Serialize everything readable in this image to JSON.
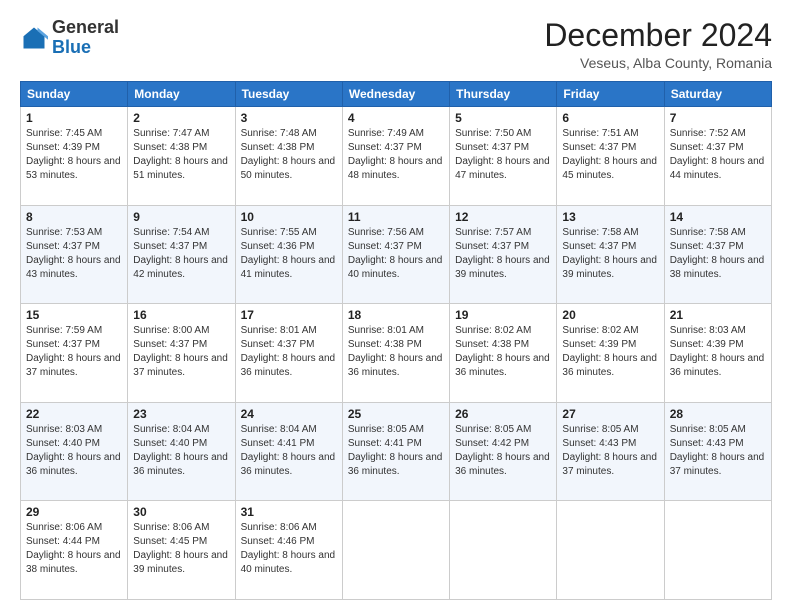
{
  "header": {
    "logo_line1": "General",
    "logo_line2": "Blue",
    "month_title": "December 2024",
    "location": "Veseus, Alba County, Romania"
  },
  "weekdays": [
    "Sunday",
    "Monday",
    "Tuesday",
    "Wednesday",
    "Thursday",
    "Friday",
    "Saturday"
  ],
  "weeks": [
    [
      {
        "day": "1",
        "sunrise": "7:45 AM",
        "sunset": "4:39 PM",
        "daylight": "8 hours and 53 minutes."
      },
      {
        "day": "2",
        "sunrise": "7:47 AM",
        "sunset": "4:38 PM",
        "daylight": "8 hours and 51 minutes."
      },
      {
        "day": "3",
        "sunrise": "7:48 AM",
        "sunset": "4:38 PM",
        "daylight": "8 hours and 50 minutes."
      },
      {
        "day": "4",
        "sunrise": "7:49 AM",
        "sunset": "4:37 PM",
        "daylight": "8 hours and 48 minutes."
      },
      {
        "day": "5",
        "sunrise": "7:50 AM",
        "sunset": "4:37 PM",
        "daylight": "8 hours and 47 minutes."
      },
      {
        "day": "6",
        "sunrise": "7:51 AM",
        "sunset": "4:37 PM",
        "daylight": "8 hours and 45 minutes."
      },
      {
        "day": "7",
        "sunrise": "7:52 AM",
        "sunset": "4:37 PM",
        "daylight": "8 hours and 44 minutes."
      }
    ],
    [
      {
        "day": "8",
        "sunrise": "7:53 AM",
        "sunset": "4:37 PM",
        "daylight": "8 hours and 43 minutes."
      },
      {
        "day": "9",
        "sunrise": "7:54 AM",
        "sunset": "4:37 PM",
        "daylight": "8 hours and 42 minutes."
      },
      {
        "day": "10",
        "sunrise": "7:55 AM",
        "sunset": "4:36 PM",
        "daylight": "8 hours and 41 minutes."
      },
      {
        "day": "11",
        "sunrise": "7:56 AM",
        "sunset": "4:37 PM",
        "daylight": "8 hours and 40 minutes."
      },
      {
        "day": "12",
        "sunrise": "7:57 AM",
        "sunset": "4:37 PM",
        "daylight": "8 hours and 39 minutes."
      },
      {
        "day": "13",
        "sunrise": "7:58 AM",
        "sunset": "4:37 PM",
        "daylight": "8 hours and 39 minutes."
      },
      {
        "day": "14",
        "sunrise": "7:58 AM",
        "sunset": "4:37 PM",
        "daylight": "8 hours and 38 minutes."
      }
    ],
    [
      {
        "day": "15",
        "sunrise": "7:59 AM",
        "sunset": "4:37 PM",
        "daylight": "8 hours and 37 minutes."
      },
      {
        "day": "16",
        "sunrise": "8:00 AM",
        "sunset": "4:37 PM",
        "daylight": "8 hours and 37 minutes."
      },
      {
        "day": "17",
        "sunrise": "8:01 AM",
        "sunset": "4:37 PM",
        "daylight": "8 hours and 36 minutes."
      },
      {
        "day": "18",
        "sunrise": "8:01 AM",
        "sunset": "4:38 PM",
        "daylight": "8 hours and 36 minutes."
      },
      {
        "day": "19",
        "sunrise": "8:02 AM",
        "sunset": "4:38 PM",
        "daylight": "8 hours and 36 minutes."
      },
      {
        "day": "20",
        "sunrise": "8:02 AM",
        "sunset": "4:39 PM",
        "daylight": "8 hours and 36 minutes."
      },
      {
        "day": "21",
        "sunrise": "8:03 AM",
        "sunset": "4:39 PM",
        "daylight": "8 hours and 36 minutes."
      }
    ],
    [
      {
        "day": "22",
        "sunrise": "8:03 AM",
        "sunset": "4:40 PM",
        "daylight": "8 hours and 36 minutes."
      },
      {
        "day": "23",
        "sunrise": "8:04 AM",
        "sunset": "4:40 PM",
        "daylight": "8 hours and 36 minutes."
      },
      {
        "day": "24",
        "sunrise": "8:04 AM",
        "sunset": "4:41 PM",
        "daylight": "8 hours and 36 minutes."
      },
      {
        "day": "25",
        "sunrise": "8:05 AM",
        "sunset": "4:41 PM",
        "daylight": "8 hours and 36 minutes."
      },
      {
        "day": "26",
        "sunrise": "8:05 AM",
        "sunset": "4:42 PM",
        "daylight": "8 hours and 36 minutes."
      },
      {
        "day": "27",
        "sunrise": "8:05 AM",
        "sunset": "4:43 PM",
        "daylight": "8 hours and 37 minutes."
      },
      {
        "day": "28",
        "sunrise": "8:05 AM",
        "sunset": "4:43 PM",
        "daylight": "8 hours and 37 minutes."
      }
    ],
    [
      {
        "day": "29",
        "sunrise": "8:06 AM",
        "sunset": "4:44 PM",
        "daylight": "8 hours and 38 minutes."
      },
      {
        "day": "30",
        "sunrise": "8:06 AM",
        "sunset": "4:45 PM",
        "daylight": "8 hours and 39 minutes."
      },
      {
        "day": "31",
        "sunrise": "8:06 AM",
        "sunset": "4:46 PM",
        "daylight": "8 hours and 40 minutes."
      },
      null,
      null,
      null,
      null
    ]
  ]
}
